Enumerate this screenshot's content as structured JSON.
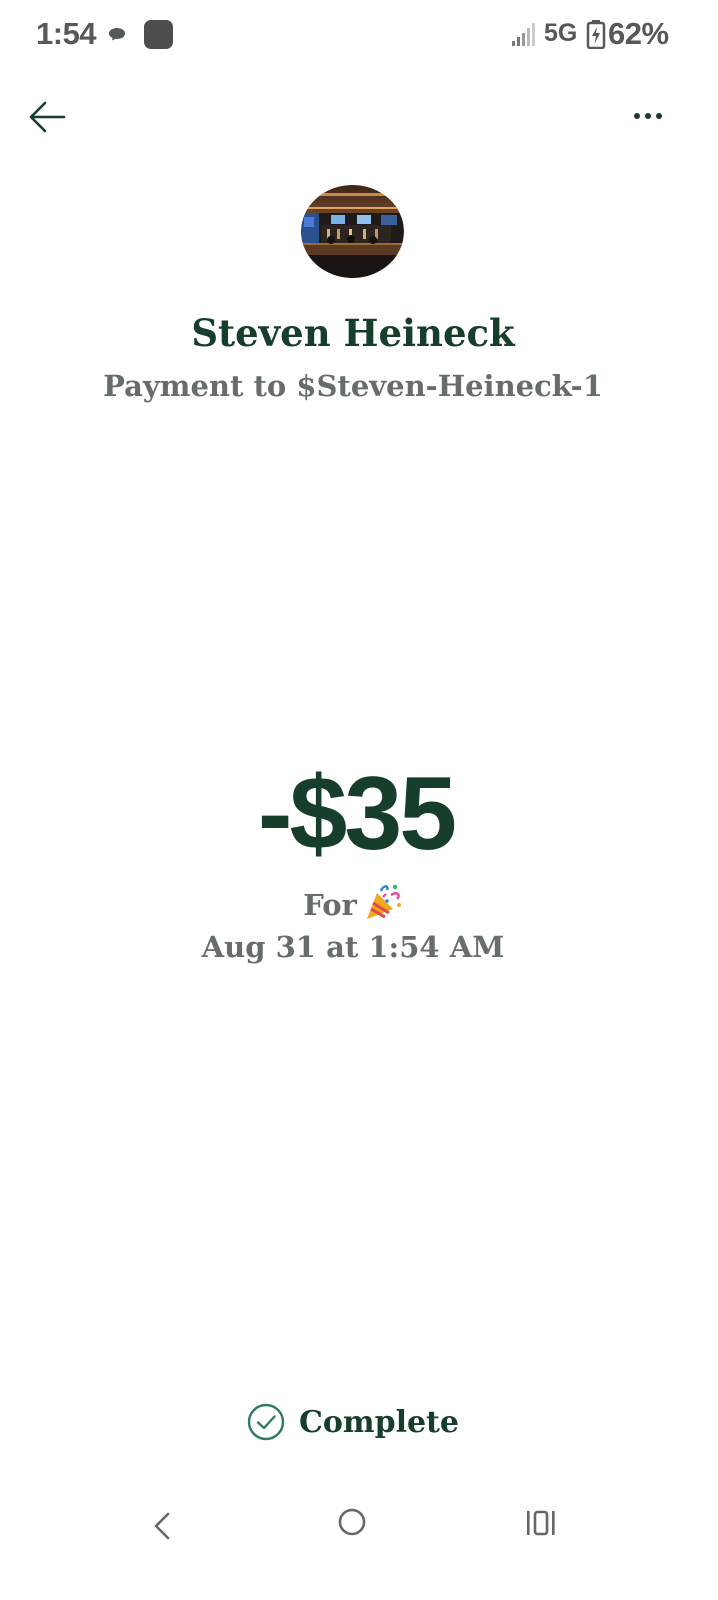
{
  "status_bar": {
    "time": "1:54",
    "network": "5G",
    "battery": "62%",
    "icons": [
      "message-icon",
      "app-icon",
      "signal-icon",
      "battery-charging-icon"
    ]
  },
  "header": {
    "back_icon": "arrow-left-icon",
    "more_icon": "more-horizontal-icon"
  },
  "recipient": {
    "name": "Steven Heineck",
    "handle": "Payment to $Steven-Heineck-1"
  },
  "payment": {
    "amount": "-$35",
    "for_label": "For",
    "for_emoji": "party-popper-icon",
    "date": "Aug 31 at 1:54 AM",
    "status": "Complete"
  },
  "system_nav": [
    "back-chevron-icon",
    "home-circle-icon",
    "recents-icon"
  ],
  "colors": {
    "primary_text": "#173d2b",
    "secondary_text": "#666e6a",
    "status_check": "#2e7d5b",
    "status_bar_text": "#555a57"
  }
}
